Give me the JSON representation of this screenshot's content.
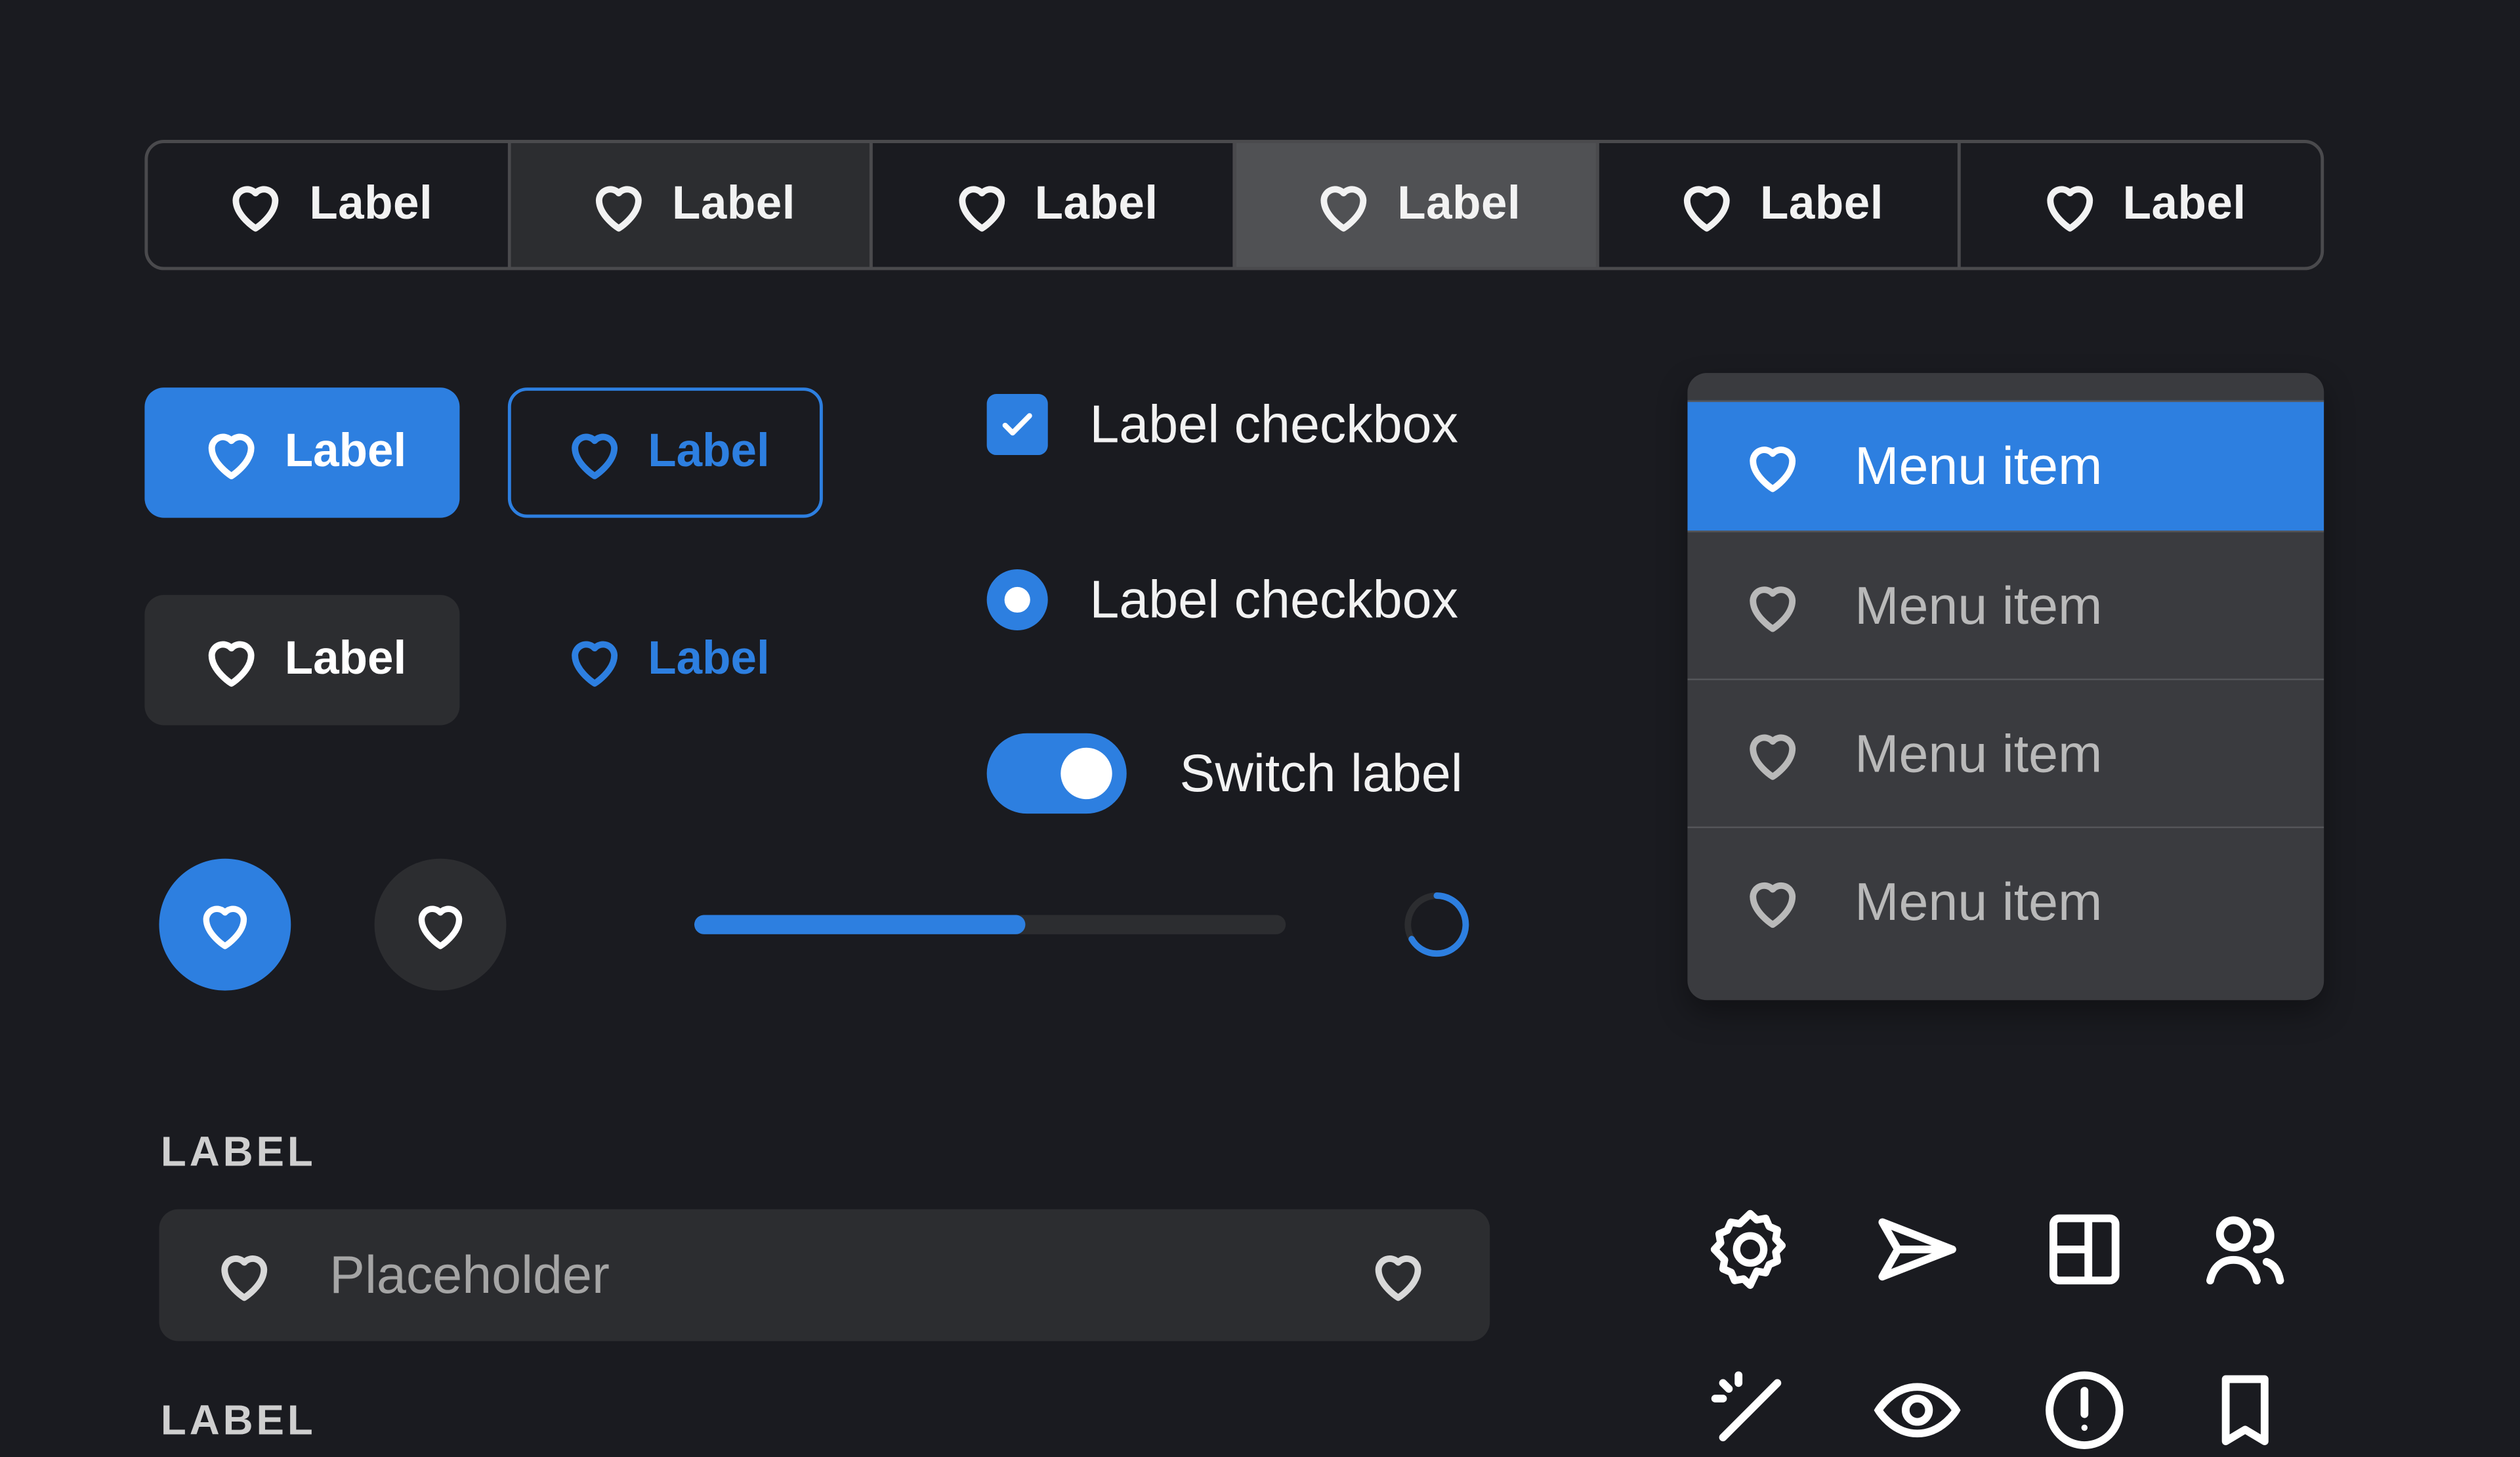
{
  "segmented": {
    "items": [
      {
        "label": "Label"
      },
      {
        "label": "Label"
      },
      {
        "label": "Label"
      },
      {
        "label": "Label"
      },
      {
        "label": "Label"
      },
      {
        "label": "Label"
      }
    ]
  },
  "buttons": {
    "filled_label": "Label",
    "outline_label": "Label",
    "dark_label": "Label",
    "text_label": "Label"
  },
  "controls": {
    "checkbox_label": "Label checkbox",
    "radio_label": "Label checkbox",
    "switch_label": "Switch label",
    "progress_fraction": 0.56
  },
  "menu": {
    "items": [
      {
        "label": "Menu item"
      },
      {
        "label": "Menu item"
      },
      {
        "label": "Menu item"
      },
      {
        "label": "Menu item"
      }
    ]
  },
  "form": {
    "label": "LABEL",
    "placeholder": "Placeholder",
    "second_label": "LABEL"
  },
  "icons": {
    "row1": [
      "gear-icon",
      "send-icon",
      "layout-icon",
      "users-icon"
    ],
    "row2": [
      "magic-wand-icon",
      "eye-icon",
      "alert-icon",
      "bookmark-icon"
    ]
  },
  "colors": {
    "accent": "#2d7fe0",
    "background": "#1a1b20"
  }
}
